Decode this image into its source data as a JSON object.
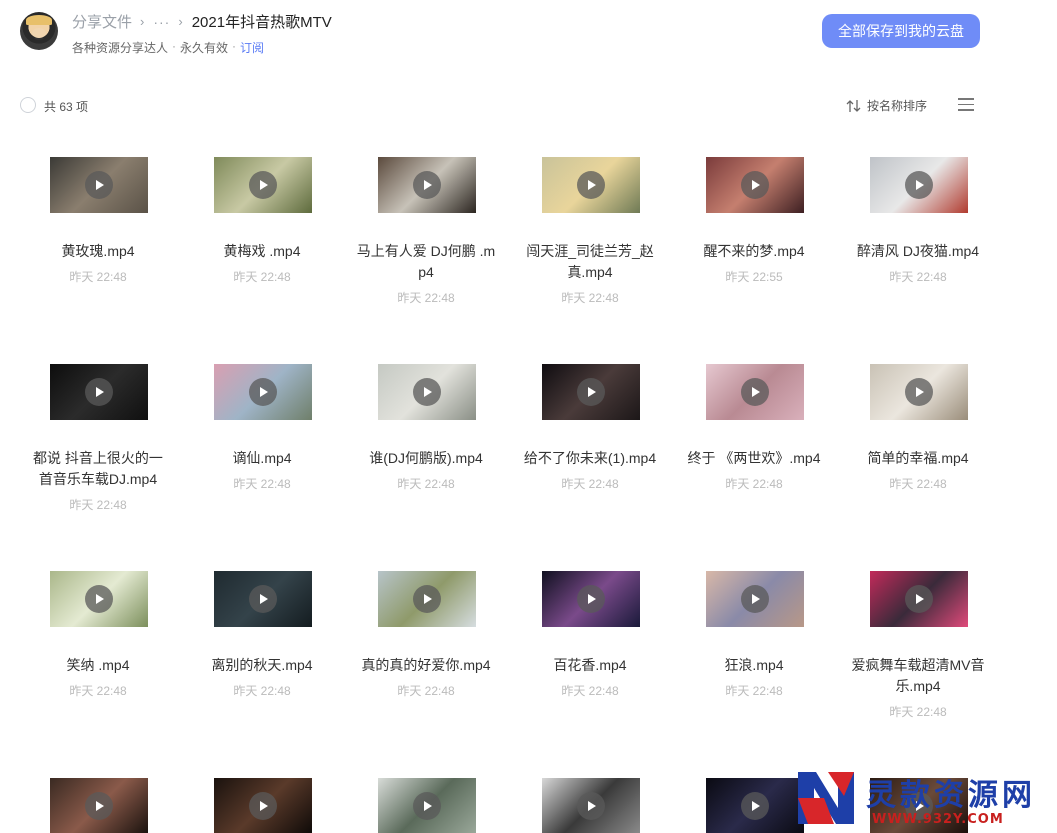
{
  "header": {
    "breadcrumb_root": "分享文件",
    "breadcrumb_more": "···",
    "breadcrumb_current": "2021年抖音热歌MTV",
    "owner": "各种资源分享达人",
    "validity": "永久有效",
    "subscribe": "订阅",
    "save_all_button": "全部保存到我的云盘",
    "accent_color": "#6f8cf7"
  },
  "toolbar": {
    "count_label": "共 63 项",
    "sort_label": "按名称排序"
  },
  "files": [
    {
      "name": "黄玫瑰.mp4",
      "time": "昨天 22:48",
      "thumb": [
        "#3b3a36",
        "#8a7e6e",
        "#5a5247"
      ]
    },
    {
      "name": "黄梅戏 .mp4",
      "time": "昨天 22:48",
      "thumb": [
        "#7f8a5a",
        "#c8c9a4",
        "#5e6b3d"
      ]
    },
    {
      "name": "马上有人爱 DJ何鹏 .mp4",
      "time": "昨天 22:48",
      "thumb": [
        "#5b4a3d",
        "#c7c2b8",
        "#2c2620"
      ]
    },
    {
      "name": "闯天涯_司徒兰芳_赵真.mp4",
      "time": "昨天 22:48",
      "thumb": [
        "#c9c39a",
        "#e9d59b",
        "#6f7a55"
      ]
    },
    {
      "name": "醒不来的梦.mp4",
      "time": "昨天 22:55",
      "thumb": [
        "#7a3b3b",
        "#c57f6f",
        "#3d1f22"
      ]
    },
    {
      "name": "醉清风 DJ夜猫.mp4",
      "time": "昨天 22:48",
      "thumb": [
        "#bfc3c8",
        "#e8e8e8",
        "#b13b2f"
      ]
    },
    {
      "name": "都说 抖音上很火的一首音乐车载DJ.mp4",
      "time": "昨天 22:48",
      "thumb": [
        "#0d0d0d",
        "#2b2b2b",
        "#101010"
      ]
    },
    {
      "name": "谪仙.mp4",
      "time": "昨天 22:48",
      "thumb": [
        "#d99fb1",
        "#9fb4c7",
        "#6f7f6a"
      ]
    },
    {
      "name": "谁(DJ何鹏版).mp4",
      "time": "昨天 22:48",
      "thumb": [
        "#c5c9c3",
        "#e2e2dc",
        "#8a8f86"
      ]
    },
    {
      "name": "给不了你未来(1).mp4",
      "time": "昨天 22:48",
      "thumb": [
        "#0f0c10",
        "#4a3b3a",
        "#1c1718"
      ]
    },
    {
      "name": "终于 《两世欢》.mp4",
      "time": "昨天 22:48",
      "thumb": [
        "#e6c8d0",
        "#b98a93",
        "#d9b0bb"
      ]
    },
    {
      "name": "简单的幸福.mp4",
      "time": "昨天 22:48",
      "thumb": [
        "#c9c2b5",
        "#ebe6de",
        "#9a8d7a"
      ]
    },
    {
      "name": "笑纳 .mp4",
      "time": "昨天 22:48",
      "thumb": [
        "#aab78a",
        "#e4ead2",
        "#7c8f5c"
      ]
    },
    {
      "name": "离别的秋天.mp4",
      "time": "昨天 22:48",
      "thumb": [
        "#1f2a30",
        "#34434a",
        "#141c20"
      ]
    },
    {
      "name": "真的真的好爱你.mp4",
      "time": "昨天 22:48",
      "thumb": [
        "#b7c4c9",
        "#8f9a6a",
        "#d6dde0"
      ]
    },
    {
      "name": "百花香.mp4",
      "time": "昨天 22:48",
      "thumb": [
        "#101020",
        "#7a4a8a",
        "#1a1a3a"
      ]
    },
    {
      "name": "狂浪.mp4",
      "time": "昨天 22:48",
      "thumb": [
        "#d8b8a8",
        "#8a8aa8",
        "#b89888"
      ]
    },
    {
      "name": "爱疯舞车载超清MV音乐.mp4",
      "time": "昨天 22:48",
      "thumb": [
        "#c22a5a",
        "#3a2a3a",
        "#e04a7a"
      ]
    },
    {
      "name": "",
      "time": "",
      "thumb": [
        "#3a2a22",
        "#8a5a4a",
        "#1a120e"
      ]
    },
    {
      "name": "",
      "time": "",
      "thumb": [
        "#1a120e",
        "#5a3a2a",
        "#0e0a08"
      ]
    },
    {
      "name": "",
      "time": "",
      "thumb": [
        "#d8dcd8",
        "#5a6a5a",
        "#9aa89a"
      ]
    },
    {
      "name": "",
      "time": "",
      "thumb": [
        "#d8d8d8",
        "#3a3a3a",
        "#8a8a8a"
      ]
    },
    {
      "name": "",
      "time": "",
      "thumb": [
        "#0a0a12",
        "#2a2a4a",
        "#0a0a12"
      ]
    },
    {
      "name": "",
      "time": "",
      "thumb": [
        "#2a1a12",
        "#6a4a3a",
        "#1a0e0a"
      ]
    }
  ],
  "watermark": {
    "text": "灵款资源网",
    "url": "WWW.932Y.COM"
  }
}
